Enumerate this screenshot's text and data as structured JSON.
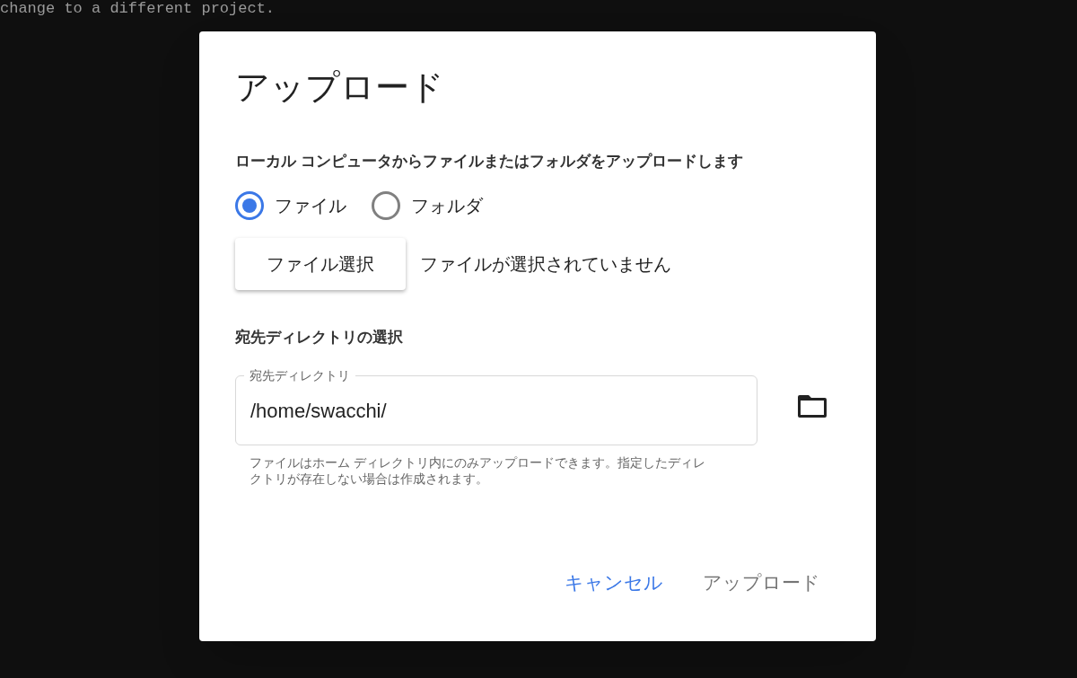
{
  "terminal": {
    "text": "change to a different project."
  },
  "dialog": {
    "title": "アップロード",
    "description": "ローカル コンピュータからファイルまたはフォルダをアップロードします",
    "upload_type": [
      {
        "label": "ファイル",
        "selected": true
      },
      {
        "label": "フォルダ",
        "selected": false
      }
    ],
    "choose_button": "ファイル選択",
    "file_status": "ファイルが選択されていません",
    "destination_heading": "宛先ディレクトリの選択",
    "destination_field": {
      "label": "宛先ディレクトリ",
      "value": "/home/swacchi/"
    },
    "helper_text": "ファイルはホーム ディレクトリ内にのみアップロードできます。指定したディレクトリが存在しない場合は作成されます。",
    "actions": [
      {
        "label": "キャンセル",
        "disabled": false
      },
      {
        "label": "アップロード",
        "disabled": true
      }
    ]
  }
}
